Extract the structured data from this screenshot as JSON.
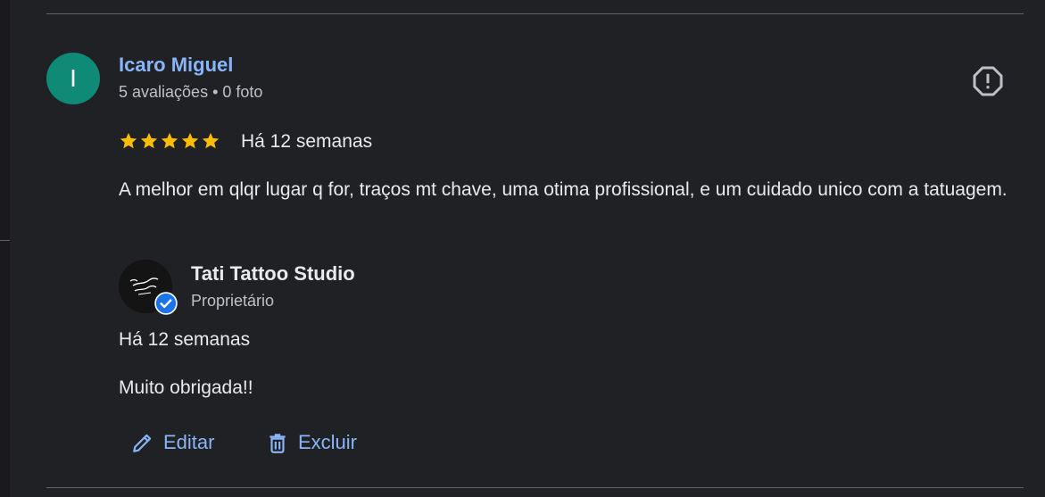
{
  "review": {
    "avatar_initial": "I",
    "reviewer_name": "Icaro Miguel",
    "reviewer_meta": "5 avaliações • 0 foto",
    "rating": 5,
    "date": "Há 12 semanas",
    "text": "A melhor em qlqr lugar q for, traços mt chave, uma otima profissional, e um cuidado unico com a tatuagem."
  },
  "owner_reply": {
    "owner_name": "Tati Tattoo Studio",
    "owner_role": "Proprietário",
    "date": "Há 12 semanas",
    "text": "Muito obrigada!!"
  },
  "actions": {
    "edit_label": "Editar",
    "delete_label": "Excluir"
  },
  "icons": {
    "report": "report-icon",
    "star": "star-icon",
    "verified": "verified-badge-icon",
    "edit": "pencil-icon",
    "delete": "trash-icon"
  },
  "colors": {
    "background": "#202124",
    "accent": "#8ab4f8",
    "star": "#fbbc04",
    "avatar": "#0f8a77",
    "verified": "#1a73e8",
    "divider": "#5f6368"
  }
}
